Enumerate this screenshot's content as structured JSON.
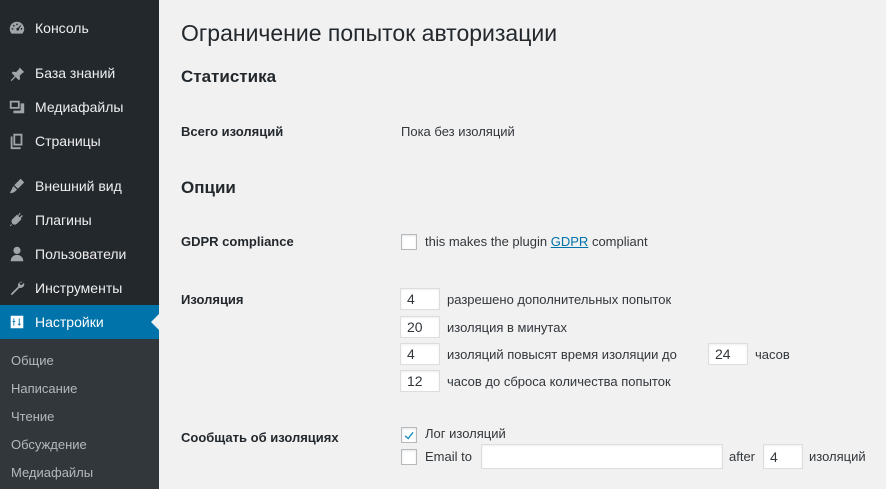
{
  "sidebar": {
    "items": [
      {
        "label": "Консоль",
        "icon": "dashboard-icon"
      },
      {
        "label": "База знаний",
        "icon": "pin-icon"
      },
      {
        "label": "Медиафайлы",
        "icon": "media-icon"
      },
      {
        "label": "Страницы",
        "icon": "pages-icon"
      },
      {
        "label": "Внешний вид",
        "icon": "appearance-icon"
      },
      {
        "label": "Плагины",
        "icon": "plugins-icon"
      },
      {
        "label": "Пользователи",
        "icon": "users-icon"
      },
      {
        "label": "Инструменты",
        "icon": "tools-icon"
      },
      {
        "label": "Настройки",
        "icon": "settings-icon",
        "active": true
      }
    ],
    "submenu": [
      "Общие",
      "Написание",
      "Чтение",
      "Обсуждение",
      "Медиафайлы"
    ]
  },
  "page": {
    "title": "Ограничение попыток авторизации",
    "stats_heading": "Статистика",
    "total_label": "Всего изоляций",
    "total_value": "Пока без изоляций",
    "options_heading": "Опции",
    "gdpr_label": "GDPR compliance",
    "gdpr_text_before": "this makes the plugin",
    "gdpr_link": "GDPR",
    "gdpr_text_after": "compliant",
    "gdpr_checked": false,
    "isolation_label": "Изоляция",
    "allowed_retries": "4",
    "allowed_retries_text": "разрешено дополнительных попыток",
    "lockout_minutes": "20",
    "lockout_minutes_text": "изоляция в минутах",
    "lockouts_increase": "4",
    "lockouts_increase_text": "изоляций повысят время изоляции до",
    "long_duration": "24",
    "long_duration_text": "часов",
    "valid_duration": "12",
    "valid_duration_text": "часов до сброса количества попыток",
    "notify_label": "Сообщать об изоляциях",
    "log_text": "Лог изоляций",
    "log_checked": true,
    "email_text": "Email to",
    "email_value": "",
    "email_checked": false,
    "after_text": "after",
    "notify_after": "4",
    "notify_after_text": "изоляций"
  },
  "colors": {
    "sidebar_bg": "#23282d",
    "active_bg": "#0073aa",
    "submenu_bg": "#32373c",
    "page_bg": "#f1f1f1",
    "link": "#0073aa",
    "check": "#1e8cbe"
  }
}
